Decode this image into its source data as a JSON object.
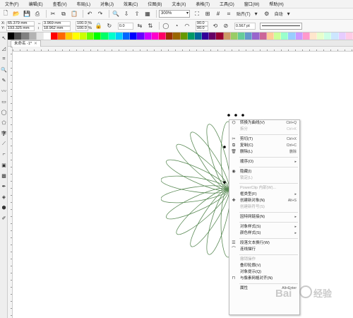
{
  "menubar": {
    "items": [
      "文件(F)",
      "编辑(E)",
      "查看(V)",
      "布局(L)",
      "对象(J)",
      "效果(C)",
      "位图(B)",
      "文本(X)",
      "表格(T)",
      "工具(O)",
      "窗口(W)",
      "帮助(H)"
    ]
  },
  "toolbar": {
    "zoom": "300%",
    "snap_label": "贴齐(T)",
    "auto_label": "自动"
  },
  "propbar": {
    "x_label": "X:",
    "x_value": "65.379 mm",
    "y_label": "Y:",
    "y_value": "193.325 mm",
    "w_value": "3.969 mm",
    "h_value": "18.962 mm",
    "scale_w": "100.0",
    "scale_h": "100.0",
    "pct": "%",
    "angle": "0.0",
    "outline_a": "90.0",
    "outline_b": "90.0",
    "pt_value": "0.567 pt"
  },
  "doc_tab": {
    "title": "未命名 -1*",
    "close": "✕"
  },
  "palette": {
    "colors": [
      "#000000",
      "#4d4d4d",
      "#808080",
      "#b3b3b3",
      "#e6e6e6",
      "#ffffff",
      "#ff0000",
      "#ff6600",
      "#ffcc00",
      "#ffff00",
      "#ccff00",
      "#66ff00",
      "#00ff00",
      "#00ff66",
      "#00ffcc",
      "#00ccff",
      "#0066ff",
      "#0000ff",
      "#6600ff",
      "#cc00ff",
      "#ff00cc",
      "#ff0066",
      "#993300",
      "#996600",
      "#669900",
      "#009966",
      "#006699",
      "#330099",
      "#660066",
      "#990033",
      "#cc9966",
      "#99cc66",
      "#66cc99",
      "#6699cc",
      "#9966cc",
      "#cc6699",
      "#ffcc99",
      "#ccff99",
      "#99ffcc",
      "#99ccff",
      "#cc99ff",
      "#ff99cc",
      "#ffe6cc",
      "#e6ffcc",
      "#ccffe6",
      "#cce6ff",
      "#e6ccff",
      "#ffcce6"
    ]
  },
  "flower": {
    "stroke": "#5a8a55",
    "petals": 12
  },
  "context_menu": {
    "items": [
      {
        "label": "转换为曲线(V)",
        "shortcut": "Ctrl+Q",
        "icon": "convert-curve-icon",
        "glyph": "⌬",
        "disabled": false
      },
      {
        "label": "拆分",
        "shortcut": "Ctrl+K",
        "icon": "break-apart-icon",
        "glyph": "",
        "disabled": true
      },
      {
        "sep": true
      },
      {
        "label": "剪切(T)",
        "shortcut": "Ctrl+X",
        "icon": "cut-icon",
        "glyph": "✂",
        "disabled": false
      },
      {
        "label": "复制(C)",
        "shortcut": "Ctrl+C",
        "icon": "copy-icon",
        "glyph": "⧉",
        "disabled": false
      },
      {
        "label": "删除(L)",
        "shortcut": "删除",
        "icon": "delete-icon",
        "glyph": "🗑",
        "disabled": false
      },
      {
        "sep": true
      },
      {
        "label": "顺序(O)",
        "shortcut": "",
        "arrow": true,
        "icon": "",
        "glyph": "",
        "disabled": false
      },
      {
        "sep": true
      },
      {
        "label": "隐藏(I)",
        "shortcut": "",
        "icon": "hide-icon",
        "glyph": "◉",
        "disabled": false
      },
      {
        "label": "锁定(L)",
        "shortcut": "",
        "icon": "lock-icon",
        "glyph": "",
        "disabled": true
      },
      {
        "sep": true
      },
      {
        "label": "PowerClip 内部(W)...",
        "shortcut": "",
        "icon": "",
        "glyph": "",
        "disabled": true
      },
      {
        "label": "框类型(F)",
        "shortcut": "",
        "arrow": true,
        "icon": "",
        "glyph": "",
        "disabled": false
      },
      {
        "label": "创建新对象(N)",
        "shortcut": "Alt+S",
        "icon": "new-object-icon",
        "glyph": "✚",
        "disabled": false
      },
      {
        "label": "创建新符号(S)",
        "shortcut": "",
        "icon": "",
        "glyph": "",
        "disabled": true
      },
      {
        "sep": true
      },
      {
        "label": "因特网链接(N)",
        "shortcut": "",
        "arrow": true,
        "icon": "",
        "glyph": "",
        "disabled": false
      },
      {
        "sep": true
      },
      {
        "label": "对象样式(S)",
        "shortcut": "",
        "arrow": true,
        "icon": "",
        "glyph": "",
        "disabled": false
      },
      {
        "label": "颜色样式(S)",
        "shortcut": "",
        "arrow": true,
        "icon": "",
        "glyph": "",
        "disabled": false
      },
      {
        "sep": true
      },
      {
        "label": "段落文本换行(W)",
        "shortcut": "",
        "icon": "text-wrap-icon",
        "glyph": "☰",
        "disabled": false
      },
      {
        "label": "连线描行",
        "shortcut": "",
        "icon": "connector-icon",
        "glyph": "⌒",
        "disabled": false
      },
      {
        "sep": true
      },
      {
        "label": "撤销操作",
        "shortcut": "",
        "icon": "",
        "glyph": "",
        "disabled": true
      },
      {
        "label": "叠印轮廓(V)",
        "shortcut": "",
        "icon": "",
        "glyph": "",
        "disabled": false
      },
      {
        "label": "对象提示(Q)",
        "shortcut": "",
        "icon": "",
        "glyph": "",
        "disabled": false
      },
      {
        "label": "与像素网格对齐(N)",
        "shortcut": "",
        "icon": "pixel-align-icon",
        "glyph": "⊓",
        "disabled": false
      },
      {
        "sep": true
      },
      {
        "label": "属性",
        "shortcut": "Alt+Enter",
        "icon": "",
        "glyph": "",
        "disabled": false
      }
    ]
  }
}
